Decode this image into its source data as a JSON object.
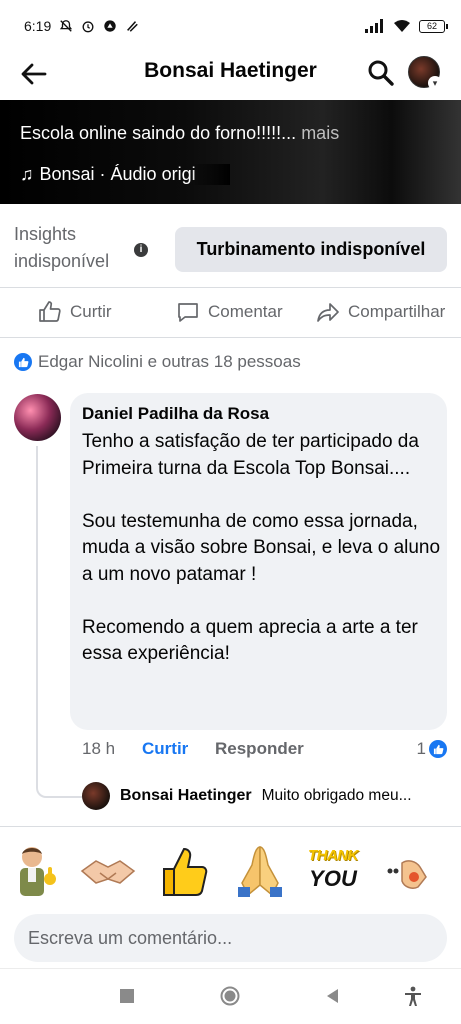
{
  "status_bar": {
    "time": "6:19",
    "battery": "62"
  },
  "header": {
    "title": "Bonsai Haetinger"
  },
  "video": {
    "caption": "Escola online saindo do forno!!!!!...",
    "more": "mais",
    "audio_note": "♫",
    "audio_label": "Bonsai  · Áudio origi"
  },
  "insights": {
    "label": "Insights indisponível",
    "info_glyph": "i",
    "boost_label": "Turbinamento indisponível"
  },
  "actions": {
    "like": "Curtir",
    "comment": "Comentar",
    "share": "Compartilhar"
  },
  "reactions": {
    "summary": "Edgar Nicolini e outras 18 pessoas"
  },
  "comment": {
    "author": "Daniel Padilha da Rosa",
    "text": "Tenho a satisfação de ter participado da Primeira turna da Escola Top Bonsai....\n\nSou testemunha de como essa jornada, muda  a visão sobre Bonsai, e leva o aluno a um novo patamar !\n\nRecomendo a quem aprecia a arte a ter essa experiência!",
    "time": "18 h",
    "like_label": "Curtir",
    "reply_label": "Responder",
    "like_count": "1"
  },
  "reply": {
    "author": "Bonsai Haetinger",
    "text": "Muito obrigado meu..."
  },
  "stickers": {
    "items": [
      "man-thumbs-up",
      "handshake",
      "thumbs-up",
      "praying-hands",
      "thank-you",
      "hand"
    ],
    "thank_you_line1": "THANK",
    "thank_you_line2": "YOU"
  },
  "composer": {
    "placeholder": "Escreva um comentário..."
  },
  "colors": {
    "accent": "#1877f2",
    "secondary_text": "#65676b",
    "bubble": "#f0f2f5"
  }
}
